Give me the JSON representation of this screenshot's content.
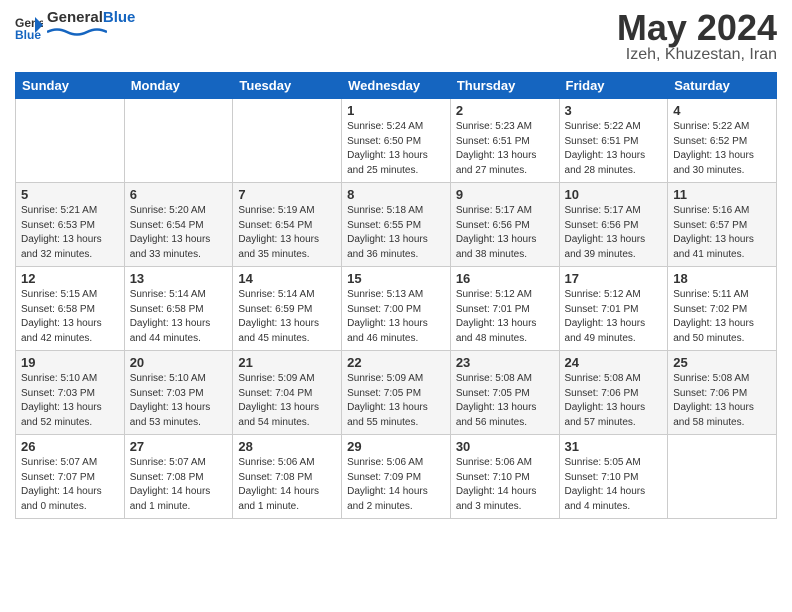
{
  "logo": {
    "general": "General",
    "blue": "Blue"
  },
  "title": "May 2024",
  "location": "Izeh, Khuzestan, Iran",
  "weekdays": [
    "Sunday",
    "Monday",
    "Tuesday",
    "Wednesday",
    "Thursday",
    "Friday",
    "Saturday"
  ],
  "weeks": [
    [
      {
        "day": "",
        "info": ""
      },
      {
        "day": "",
        "info": ""
      },
      {
        "day": "",
        "info": ""
      },
      {
        "day": "1",
        "info": "Sunrise: 5:24 AM\nSunset: 6:50 PM\nDaylight: 13 hours and 25 minutes."
      },
      {
        "day": "2",
        "info": "Sunrise: 5:23 AM\nSunset: 6:51 PM\nDaylight: 13 hours and 27 minutes."
      },
      {
        "day": "3",
        "info": "Sunrise: 5:22 AM\nSunset: 6:51 PM\nDaylight: 13 hours and 28 minutes."
      },
      {
        "day": "4",
        "info": "Sunrise: 5:22 AM\nSunset: 6:52 PM\nDaylight: 13 hours and 30 minutes."
      }
    ],
    [
      {
        "day": "5",
        "info": "Sunrise: 5:21 AM\nSunset: 6:53 PM\nDaylight: 13 hours and 32 minutes."
      },
      {
        "day": "6",
        "info": "Sunrise: 5:20 AM\nSunset: 6:54 PM\nDaylight: 13 hours and 33 minutes."
      },
      {
        "day": "7",
        "info": "Sunrise: 5:19 AM\nSunset: 6:54 PM\nDaylight: 13 hours and 35 minutes."
      },
      {
        "day": "8",
        "info": "Sunrise: 5:18 AM\nSunset: 6:55 PM\nDaylight: 13 hours and 36 minutes."
      },
      {
        "day": "9",
        "info": "Sunrise: 5:17 AM\nSunset: 6:56 PM\nDaylight: 13 hours and 38 minutes."
      },
      {
        "day": "10",
        "info": "Sunrise: 5:17 AM\nSunset: 6:56 PM\nDaylight: 13 hours and 39 minutes."
      },
      {
        "day": "11",
        "info": "Sunrise: 5:16 AM\nSunset: 6:57 PM\nDaylight: 13 hours and 41 minutes."
      }
    ],
    [
      {
        "day": "12",
        "info": "Sunrise: 5:15 AM\nSunset: 6:58 PM\nDaylight: 13 hours and 42 minutes."
      },
      {
        "day": "13",
        "info": "Sunrise: 5:14 AM\nSunset: 6:58 PM\nDaylight: 13 hours and 44 minutes."
      },
      {
        "day": "14",
        "info": "Sunrise: 5:14 AM\nSunset: 6:59 PM\nDaylight: 13 hours and 45 minutes."
      },
      {
        "day": "15",
        "info": "Sunrise: 5:13 AM\nSunset: 7:00 PM\nDaylight: 13 hours and 46 minutes."
      },
      {
        "day": "16",
        "info": "Sunrise: 5:12 AM\nSunset: 7:01 PM\nDaylight: 13 hours and 48 minutes."
      },
      {
        "day": "17",
        "info": "Sunrise: 5:12 AM\nSunset: 7:01 PM\nDaylight: 13 hours and 49 minutes."
      },
      {
        "day": "18",
        "info": "Sunrise: 5:11 AM\nSunset: 7:02 PM\nDaylight: 13 hours and 50 minutes."
      }
    ],
    [
      {
        "day": "19",
        "info": "Sunrise: 5:10 AM\nSunset: 7:03 PM\nDaylight: 13 hours and 52 minutes."
      },
      {
        "day": "20",
        "info": "Sunrise: 5:10 AM\nSunset: 7:03 PM\nDaylight: 13 hours and 53 minutes."
      },
      {
        "day": "21",
        "info": "Sunrise: 5:09 AM\nSunset: 7:04 PM\nDaylight: 13 hours and 54 minutes."
      },
      {
        "day": "22",
        "info": "Sunrise: 5:09 AM\nSunset: 7:05 PM\nDaylight: 13 hours and 55 minutes."
      },
      {
        "day": "23",
        "info": "Sunrise: 5:08 AM\nSunset: 7:05 PM\nDaylight: 13 hours and 56 minutes."
      },
      {
        "day": "24",
        "info": "Sunrise: 5:08 AM\nSunset: 7:06 PM\nDaylight: 13 hours and 57 minutes."
      },
      {
        "day": "25",
        "info": "Sunrise: 5:08 AM\nSunset: 7:06 PM\nDaylight: 13 hours and 58 minutes."
      }
    ],
    [
      {
        "day": "26",
        "info": "Sunrise: 5:07 AM\nSunset: 7:07 PM\nDaylight: 14 hours and 0 minutes."
      },
      {
        "day": "27",
        "info": "Sunrise: 5:07 AM\nSunset: 7:08 PM\nDaylight: 14 hours and 1 minute."
      },
      {
        "day": "28",
        "info": "Sunrise: 5:06 AM\nSunset: 7:08 PM\nDaylight: 14 hours and 1 minute."
      },
      {
        "day": "29",
        "info": "Sunrise: 5:06 AM\nSunset: 7:09 PM\nDaylight: 14 hours and 2 minutes."
      },
      {
        "day": "30",
        "info": "Sunrise: 5:06 AM\nSunset: 7:10 PM\nDaylight: 14 hours and 3 minutes."
      },
      {
        "day": "31",
        "info": "Sunrise: 5:05 AM\nSunset: 7:10 PM\nDaylight: 14 hours and 4 minutes."
      },
      {
        "day": "",
        "info": ""
      }
    ]
  ]
}
